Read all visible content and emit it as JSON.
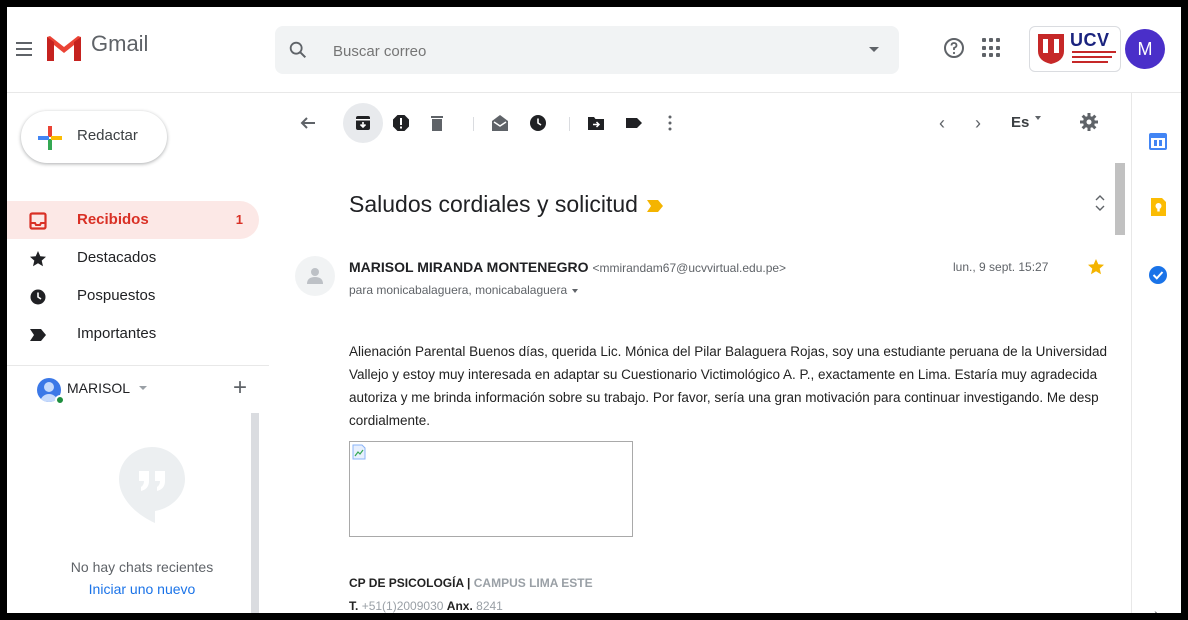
{
  "app": {
    "name": "Gmail"
  },
  "search": {
    "placeholder": "Buscar correo"
  },
  "account": {
    "avatar_letter": "M",
    "org_logo": "UCV"
  },
  "compose": {
    "label": "Redactar"
  },
  "sidebar": {
    "items": [
      {
        "label": "Recibidos",
        "count": "1",
        "icon": "inbox-icon",
        "active": true
      },
      {
        "label": "Destacados",
        "icon": "star-icon"
      },
      {
        "label": "Pospuestos",
        "icon": "clock-icon"
      },
      {
        "label": "Importantes",
        "icon": "important-icon"
      }
    ],
    "user": {
      "name": "MARISOL"
    },
    "chat": {
      "empty_text": "No hay chats recientes",
      "start_link": "Iniciar uno nuevo"
    }
  },
  "toolbar": {
    "icons": [
      "back-arrow-icon",
      "archive-icon",
      "report-spam-icon",
      "delete-icon",
      "mark-unread-icon",
      "snooze-icon",
      "move-to-icon",
      "labels-icon",
      "more-icon"
    ],
    "language": "Es"
  },
  "email": {
    "subject": "Saludos cordiales y solicitud",
    "sender_name": "MARISOL MIRANDA MONTENEGRO",
    "sender_email": "<mmirandam67@ucvvirtual.edu.pe>",
    "recipients": "para monicabalaguera, monicabalaguera",
    "date": "lun., 9 sept. 15:27",
    "body_lines": [
      "Alienación Parental Buenos días, querida Lic. Mónica del Pilar Balaguera Rojas, soy una estudiante peruana de la Universidad",
      "Vallejo y estoy muy interesada en adaptar su Cuestionario Victimológico A. P., exactamente en Lima. Estaría muy agradecida",
      "autoriza y me brinda información sobre su trabajo. Por favor, sería una gran motivación para continuar investigando. Me desp",
      "cordialmente."
    ],
    "signature": {
      "dept": "CP DE PSICOLOGÍA",
      "separator": "|",
      "campus": "CAMPUS LIMA ESTE",
      "phone_label": "T.",
      "phone": "+51(1)2009030",
      "ext_label": "Anx.",
      "ext": "8241"
    }
  },
  "colors": {
    "accent_red": "#d93025",
    "active_bg": "#fce8e6",
    "link_blue": "#1a73e8",
    "important_yellow": "#f4b400",
    "avatar_purple": "#4a2fc9"
  }
}
